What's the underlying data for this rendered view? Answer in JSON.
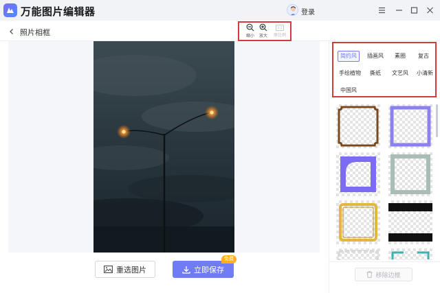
{
  "app": {
    "title": "万能图片编辑器",
    "login_label": "登录"
  },
  "subheader": {
    "page_title": "照片相框"
  },
  "zoom_tools": [
    {
      "label": "缩小",
      "icon": "zoom-out-icon",
      "enabled": true
    },
    {
      "label": "放大",
      "icon": "zoom-in-icon",
      "enabled": true
    },
    {
      "label": "原比例",
      "icon": "original-ratio-icon",
      "enabled": false,
      "icon_text": "1:1"
    }
  ],
  "styles": {
    "active": "简约风",
    "items": [
      "简约风",
      "插画风",
      "素圈",
      "复古",
      "手绘植物",
      "撕纸",
      "文艺风",
      "小清新",
      "中国风"
    ]
  },
  "frames": [
    {
      "name": "brown-ornate",
      "color": "#7a4a1f"
    },
    {
      "name": "purple-square",
      "color": "#8b82f0"
    },
    {
      "name": "purple-arch",
      "color": "#7b6cf2"
    },
    {
      "name": "sage-square",
      "color": "#a9bdb4"
    },
    {
      "name": "gold-ornate",
      "color": "#e3b640"
    },
    {
      "name": "black-bars",
      "color": "#111111"
    },
    {
      "name": "gray-partial",
      "color": "#d9d9d9"
    },
    {
      "name": "teal-dash",
      "color": "#3bb3b0"
    }
  ],
  "buttons": {
    "reselect": "重选图片",
    "save": "立即保存",
    "free_badge": "免费",
    "remove_frame": "移除边框"
  },
  "colors": {
    "accent": "#6f7cf6",
    "highlight_box": "#d23a3a",
    "badge": "#ffb020"
  }
}
